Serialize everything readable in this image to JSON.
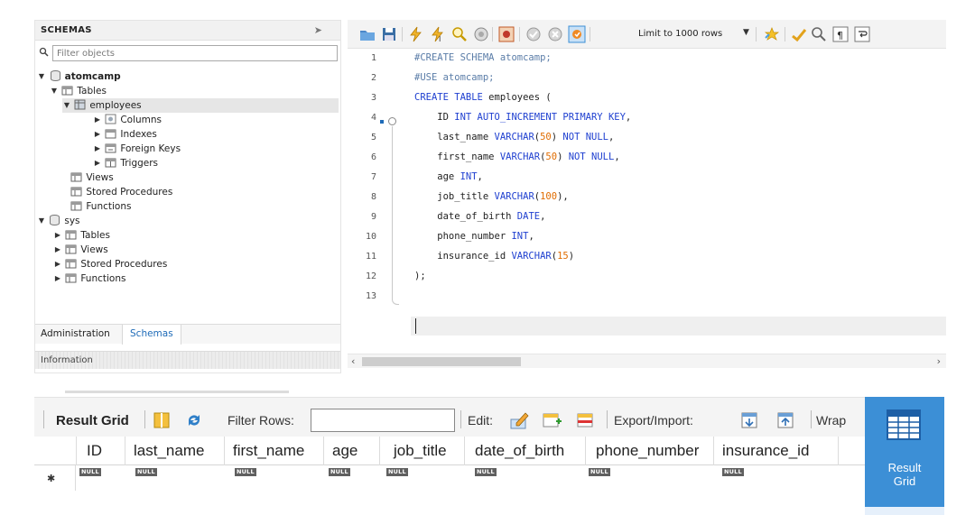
{
  "navigator": {
    "title": "SCHEMAS",
    "filter_placeholder": "Filter objects",
    "tree": [
      {
        "label": "atomcamp",
        "bold": true
      },
      {
        "label": "Tables"
      },
      {
        "label": "employees",
        "selected": true
      },
      {
        "label": "Columns"
      },
      {
        "label": "Indexes"
      },
      {
        "label": "Foreign Keys"
      },
      {
        "label": "Triggers"
      },
      {
        "label": "Views"
      },
      {
        "label": "Stored Procedures"
      },
      {
        "label": "Functions"
      },
      {
        "label": "sys"
      },
      {
        "label": "Tables"
      },
      {
        "label": "Views"
      },
      {
        "label": "Stored Procedures"
      },
      {
        "label": "Functions"
      }
    ],
    "tabs": {
      "administration": "Administration",
      "schemas": "Schemas"
    },
    "info_label": "Information"
  },
  "editor": {
    "limit_label": "Limit to 1000 rows",
    "line_numbers": [
      "1",
      "2",
      "3",
      "4",
      "5",
      "6",
      "7",
      "8",
      "9",
      "10",
      "11",
      "12",
      "13"
    ]
  },
  "result": {
    "title": "Result Grid",
    "filter_rows_label": "Filter Rows:",
    "edit_label": "Edit:",
    "export_label": "Export/Import:",
    "wrap_label": "Wrap",
    "columns": [
      "ID",
      "last_name",
      "first_name",
      "age",
      "job_title",
      "date_of_birth",
      "phone_number",
      "insurance_id"
    ],
    "null_label": "NULL",
    "side_panel_label": "Result Grid"
  },
  "colors": {
    "keyword": "#1e3fd0",
    "comment": "#5b7da8",
    "number": "#e06c00",
    "accent": "#3c8fd6"
  },
  "icons": [
    "schema-db-icon",
    "table-folder-icon",
    "table-icon",
    "columns-icon",
    "indexes-icon",
    "foreign-keys-icon",
    "triggers-icon",
    "open-folder-icon",
    "save-icon",
    "execute-icon",
    "execute-current-icon",
    "explain-icon",
    "stop-icon",
    "toggle-output-icon",
    "commit-icon",
    "rollback-icon",
    "autocommit-icon",
    "beautify-icon",
    "bookmark-icon",
    "find-icon",
    "invisible-chars-icon",
    "wrap-icon",
    "refresh-icon",
    "edit-row-icon",
    "add-row-icon",
    "delete-row-icon",
    "export-icon",
    "import-icon",
    "result-grid-icon"
  ]
}
